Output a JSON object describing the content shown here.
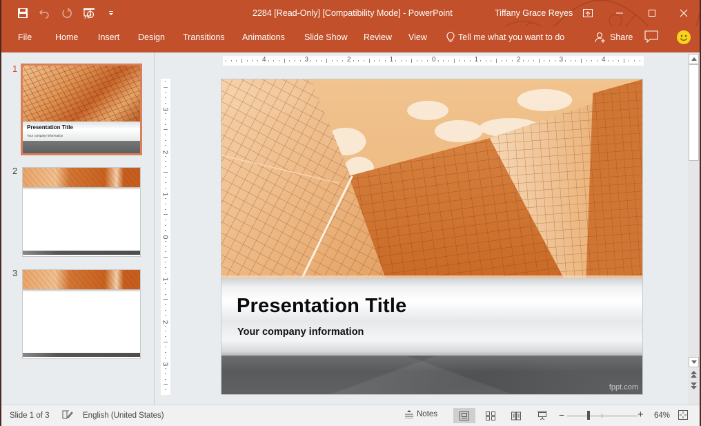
{
  "window": {
    "title": "2284 [Read-Only] [Compatibility Mode]  -  PowerPoint",
    "user": "Tiffany Grace Reyes",
    "accent_color": "#c2502a",
    "controls": [
      "ribbon-display-options",
      "minimize",
      "maximize",
      "close"
    ]
  },
  "quick_access": {
    "items": [
      "save-icon",
      "undo-icon",
      "redo-icon",
      "start-from-beginning-icon",
      "customize-qat-icon"
    ]
  },
  "ribbon": {
    "tabs": [
      {
        "label": "File"
      },
      {
        "label": "Home"
      },
      {
        "label": "Insert"
      },
      {
        "label": "Design"
      },
      {
        "label": "Transitions"
      },
      {
        "label": "Animations"
      },
      {
        "label": "Slide Show"
      },
      {
        "label": "Review"
      },
      {
        "label": "View"
      }
    ],
    "tell_me": "Tell me what you want to do",
    "share_label": "Share"
  },
  "thumbnails": [
    {
      "number": "1",
      "title": "Presentation Title",
      "subtitle": "Your company information",
      "selected": true
    },
    {
      "number": "2",
      "selected": false
    },
    {
      "number": "3",
      "selected": false
    }
  ],
  "rulers": {
    "horizontal": [
      "4",
      "3",
      "2",
      "1",
      "0",
      "1",
      "2",
      "3",
      "4"
    ],
    "vertical": [
      "3",
      "2",
      "1",
      "0",
      "1",
      "2",
      "3"
    ]
  },
  "slide": {
    "title": "Presentation Title",
    "subtitle": "Your company information",
    "brand": "fppt.com"
  },
  "statusbar": {
    "slide_info": "Slide 1 of 3",
    "language": "English (United States)",
    "notes_label": "Notes",
    "views": [
      "normal",
      "slide-sorter",
      "reading-view",
      "slide-show"
    ],
    "active_view": "normal",
    "zoom_percent": "64%",
    "zoom_value": 64
  }
}
